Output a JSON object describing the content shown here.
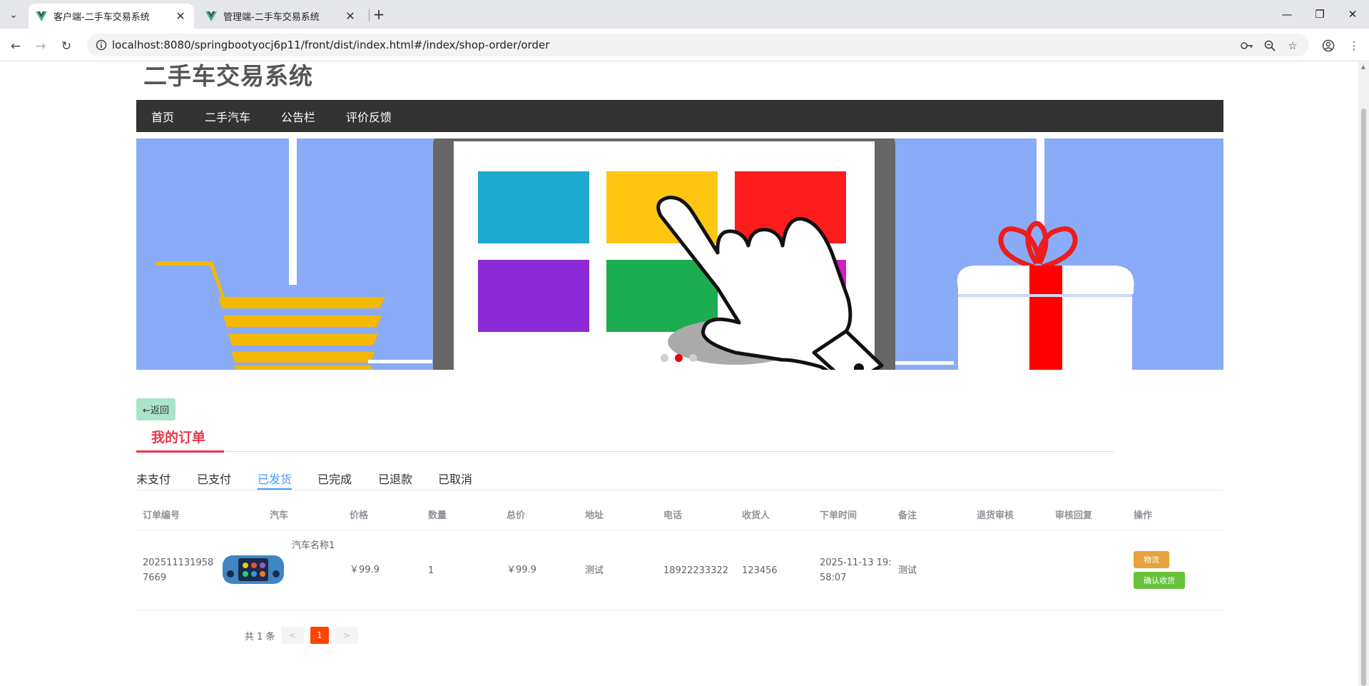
{
  "browser": {
    "tabs": [
      {
        "title": "客户端-二手车交易系统",
        "active": true
      },
      {
        "title": "管理端-二手车交易系统",
        "active": false
      }
    ],
    "url": "localhost:8080/springbootyocj6p11/front/dist/index.html#/index/shop-order/order",
    "icons": {
      "tab_menu": "chevron-down-icon",
      "close": "close-icon",
      "new_tab": "plus-icon",
      "back": "arrow-left-icon",
      "forward": "arrow-right-icon",
      "reload": "reload-icon",
      "site_info": "info-icon",
      "password": "key-icon",
      "zoom": "zoom-icon",
      "bookmark": "star-icon",
      "profile": "profile-icon",
      "menu": "kebab-menu-icon"
    }
  },
  "site": {
    "title": "二手车交易系统",
    "nav": [
      "首页",
      "二手汽车",
      "公告栏",
      "评价反馈"
    ]
  },
  "banner": {
    "dots": 3,
    "active_dot": 2
  },
  "page": {
    "back_label": "←返回",
    "section_title": "我的订单",
    "status_tabs": [
      "未支付",
      "已支付",
      "已发货",
      "已完成",
      "已退款",
      "已取消"
    ],
    "active_tab": "已发货"
  },
  "table": {
    "columns": [
      "订单编号",
      "汽车",
      "价格",
      "数量",
      "总价",
      "地址",
      "电话",
      "收货人",
      "下单时间",
      "备注",
      "退货审核",
      "审核回复",
      "操作"
    ],
    "rows": [
      {
        "order_no_line1": "202511131958",
        "order_no_line2": "7669",
        "car_name": "汽车名称1",
        "price": "￥99.9",
        "quantity": "1",
        "total": "￥99.9",
        "address": "测试",
        "phone": "18922233322",
        "consignee": "123456",
        "order_time_line1": "2025-11-13 19:",
        "order_time_line2": "58:07",
        "remark": "测试",
        "return_review": "",
        "review_reply": "",
        "actions": [
          "物流",
          "确认收货"
        ]
      }
    ]
  },
  "pagination": {
    "total_text": "共 1 条",
    "prev": "<",
    "current": "1",
    "next": ">"
  },
  "colors": {
    "nav_bg": "#333333",
    "accent_red": "#e8384f",
    "tab_active": "#409eff",
    "btn_logistics": "#e6a23c",
    "btn_confirm": "#67c23a",
    "page_current": "#ff4400",
    "back_btn": "#a9e4cb",
    "banner_bg": "#8aabf6"
  }
}
